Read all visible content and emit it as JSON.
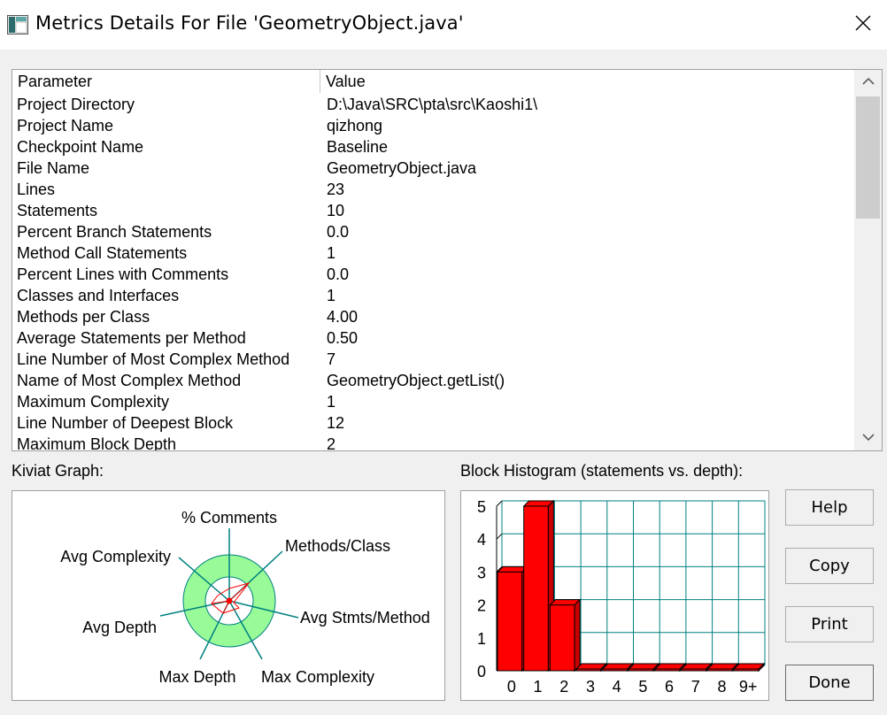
{
  "window": {
    "title": "Metrics Details For File 'GeometryObject.java'",
    "close_icon": "close-icon"
  },
  "table": {
    "headers": [
      "Parameter",
      "Value"
    ],
    "rows": [
      {
        "param": "Project Directory",
        "value": "D:\\Java\\SRC\\pta\\src\\Kaoshi1\\"
      },
      {
        "param": "Project Name",
        "value": "qizhong"
      },
      {
        "param": "Checkpoint Name",
        "value": "Baseline"
      },
      {
        "param": "File Name",
        "value": "GeometryObject.java"
      },
      {
        "param": "Lines",
        "value": "23"
      },
      {
        "param": "Statements",
        "value": "10"
      },
      {
        "param": "Percent Branch Statements",
        "value": "0.0"
      },
      {
        "param": "Method Call Statements",
        "value": "1"
      },
      {
        "param": "Percent Lines with Comments",
        "value": "0.0"
      },
      {
        "param": "Classes and Interfaces",
        "value": "1"
      },
      {
        "param": "Methods per Class",
        "value": "4.00"
      },
      {
        "param": "Average Statements per Method",
        "value": "0.50"
      },
      {
        "param": "Line Number of Most Complex Method",
        "value": "7"
      },
      {
        "param": "Name of Most Complex Method",
        "value": "GeometryObject.getList()"
      },
      {
        "param": "Maximum Complexity",
        "value": "1"
      },
      {
        "param": "Line Number of Deepest Block",
        "value": "12"
      },
      {
        "param": "Maximum Block Depth",
        "value": "2"
      }
    ]
  },
  "kiviat": {
    "label": "Kiviat Graph:",
    "axes": [
      "% Comments",
      "Methods/Class",
      "Avg Stmts/Method",
      "Max Complexity",
      "Max Depth",
      "Avg Depth",
      "Avg Complexity"
    ],
    "colors": {
      "band": "#98fb98",
      "axis": "#008080",
      "data": "#ff0000"
    }
  },
  "histogram": {
    "label": "Block Histogram (statements vs. depth):",
    "colors": {
      "bar": "#ff0000",
      "grid": "#008080"
    }
  },
  "chart_data": {
    "type": "bar",
    "title": "Block Histogram (statements vs. depth):",
    "categories": [
      "0",
      "1",
      "2",
      "3",
      "4",
      "5",
      "6",
      "7",
      "8",
      "9+"
    ],
    "values": [
      3,
      5,
      2,
      0,
      0,
      0,
      0,
      0,
      0,
      0
    ],
    "y_ticks": [
      "0",
      "1",
      "2",
      "3",
      "4",
      "5"
    ],
    "ylim": [
      0,
      5
    ],
    "grid": true
  },
  "buttons": {
    "help": "Help",
    "copy": "Copy",
    "print": "Print",
    "done": "Done"
  }
}
